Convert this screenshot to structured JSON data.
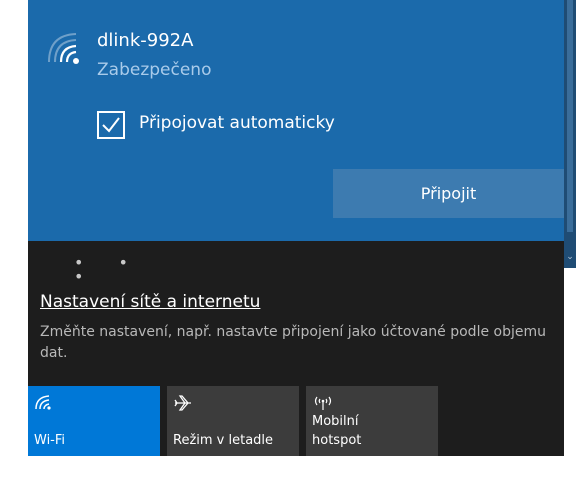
{
  "network": {
    "name": "dlink-992A",
    "status": "Zabezpečeno",
    "auto_connect_label": "Připojovat automaticky",
    "auto_connect_checked": true,
    "connect_label": "Připojit",
    "more_indicator": "• • •"
  },
  "settings": {
    "link_label": "Nastavení sítě a internetu",
    "description": "Změňte nastavení, např. nastavte připojení jako účtované podle objemu dat."
  },
  "quick_actions": [
    {
      "label": "Wi-Fi",
      "icon": "wifi-icon",
      "active": true
    },
    {
      "label": "Režim v letadle",
      "icon": "airplane-icon",
      "active": false
    },
    {
      "label_line1": "Mobilní",
      "label_line2": "hotspot",
      "icon": "hotspot-icon",
      "active": false
    }
  ],
  "colors": {
    "network_panel": "#1b6aab",
    "connect_button": "#3d7bb0",
    "dark_panel": "#1d1d1d",
    "tile_active": "#0078d7",
    "tile_inactive": "#3c3c3c",
    "status_text": "#a9cbea"
  }
}
